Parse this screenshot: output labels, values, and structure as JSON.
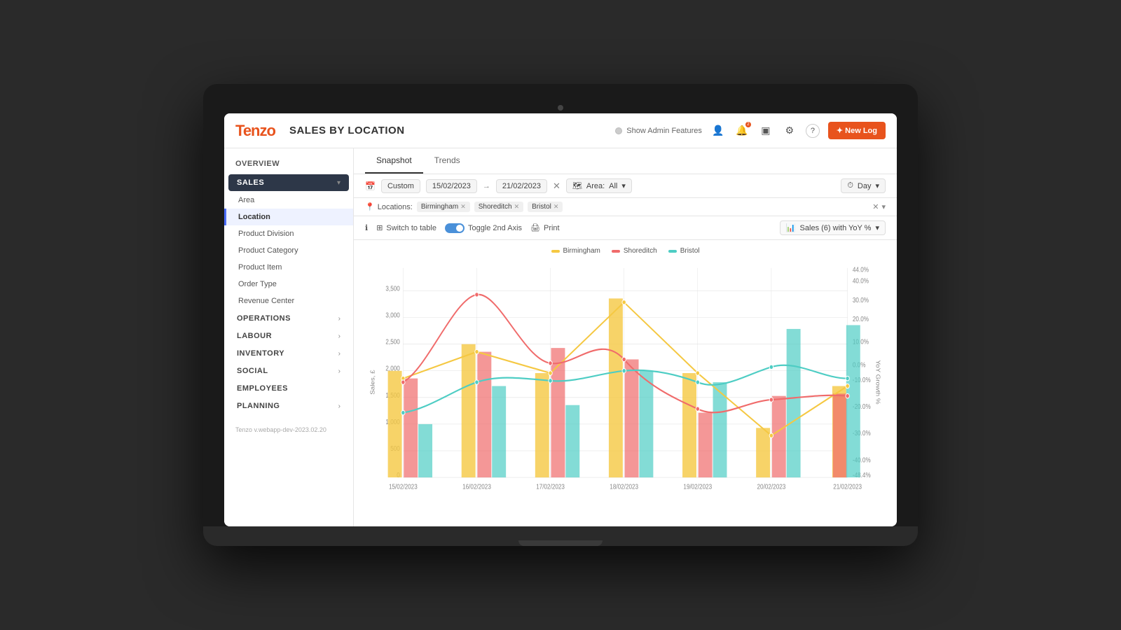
{
  "app": {
    "logo": "Tenzo",
    "page_title": "SALES BY LOCATION",
    "admin_toggle_label": "Show Admin Features",
    "new_log_label": "✦ New Log",
    "version": "Tenzo v.webapp-dev-2023.02.20"
  },
  "header": {
    "icons": {
      "user": "👤",
      "bell": "🔔",
      "tablet": "▣",
      "settings": "⚙",
      "help": "?"
    }
  },
  "tabs": [
    {
      "id": "snapshot",
      "label": "Snapshot",
      "active": true
    },
    {
      "id": "trends",
      "label": "Trends",
      "active": false
    }
  ],
  "filters": {
    "date_preset": "Custom",
    "date_from": "15/02/2023",
    "date_to": "21/02/2023",
    "area_label": "Area:",
    "area_value": "All",
    "granularity_label": "Day"
  },
  "locations_bar": {
    "label": "Locations:",
    "chips": [
      "Birmingham",
      "Shoreditch",
      "Bristol"
    ]
  },
  "chart_toolbar": {
    "info_icon": "ℹ",
    "switch_to_table": "Switch to table",
    "toggle_2nd_axis": "Toggle 2nd Axis",
    "print": "Print",
    "sales_dropdown": "Sales (6) with YoY %"
  },
  "chart": {
    "legend": [
      {
        "label": "Birmingham",
        "color": "#f5c842"
      },
      {
        "label": "Shoreditch",
        "color": "#f06b6b"
      },
      {
        "label": "Bristol",
        "color": "#4ecdc4"
      }
    ],
    "y_axis_left_label": "Sales, £",
    "y_axis_right_label": "YoY Growth %",
    "y_left_ticks": [
      "0",
      "500",
      "1,000",
      "1,500",
      "2,000",
      "2,500",
      "3,000",
      "3,500"
    ],
    "y_right_ticks": [
      "-48.4%",
      "-40.0%",
      "-30.0%",
      "-20.0%",
      "-10.0%",
      "0.0%",
      "10.0%",
      "20.0%",
      "30.0%",
      "40.0%",
      "44.0%"
    ],
    "x_ticks": [
      "15/02/2023",
      "16/02/2023",
      "17/02/2023",
      "18/02/2023",
      "19/02/2023",
      "20/02/2023",
      "21/02/2023"
    ]
  },
  "sidebar": {
    "overview_label": "OVERVIEW",
    "sections": [
      {
        "id": "sales",
        "label": "SALES",
        "active": true,
        "items": [
          {
            "id": "area",
            "label": "Area",
            "active": false
          },
          {
            "id": "location",
            "label": "Location",
            "active": true
          },
          {
            "id": "product-division",
            "label": "Product Division",
            "active": false
          },
          {
            "id": "product-category",
            "label": "Product Category",
            "active": false
          },
          {
            "id": "product-item",
            "label": "Product Item",
            "active": false
          },
          {
            "id": "order-type",
            "label": "Order Type",
            "active": false
          },
          {
            "id": "revenue-center",
            "label": "Revenue Center",
            "active": false
          }
        ]
      },
      {
        "id": "operations",
        "label": "OPERATIONS",
        "active": false,
        "items": []
      },
      {
        "id": "labour",
        "label": "LABOUR",
        "active": false,
        "items": []
      },
      {
        "id": "inventory",
        "label": "INVENTORY",
        "active": false,
        "items": []
      },
      {
        "id": "social",
        "label": "SOCIAL",
        "active": false,
        "items": []
      },
      {
        "id": "employees",
        "label": "EMPLOYEES",
        "active": false,
        "items": []
      },
      {
        "id": "planning",
        "label": "PLANNING",
        "active": false,
        "items": []
      }
    ]
  }
}
